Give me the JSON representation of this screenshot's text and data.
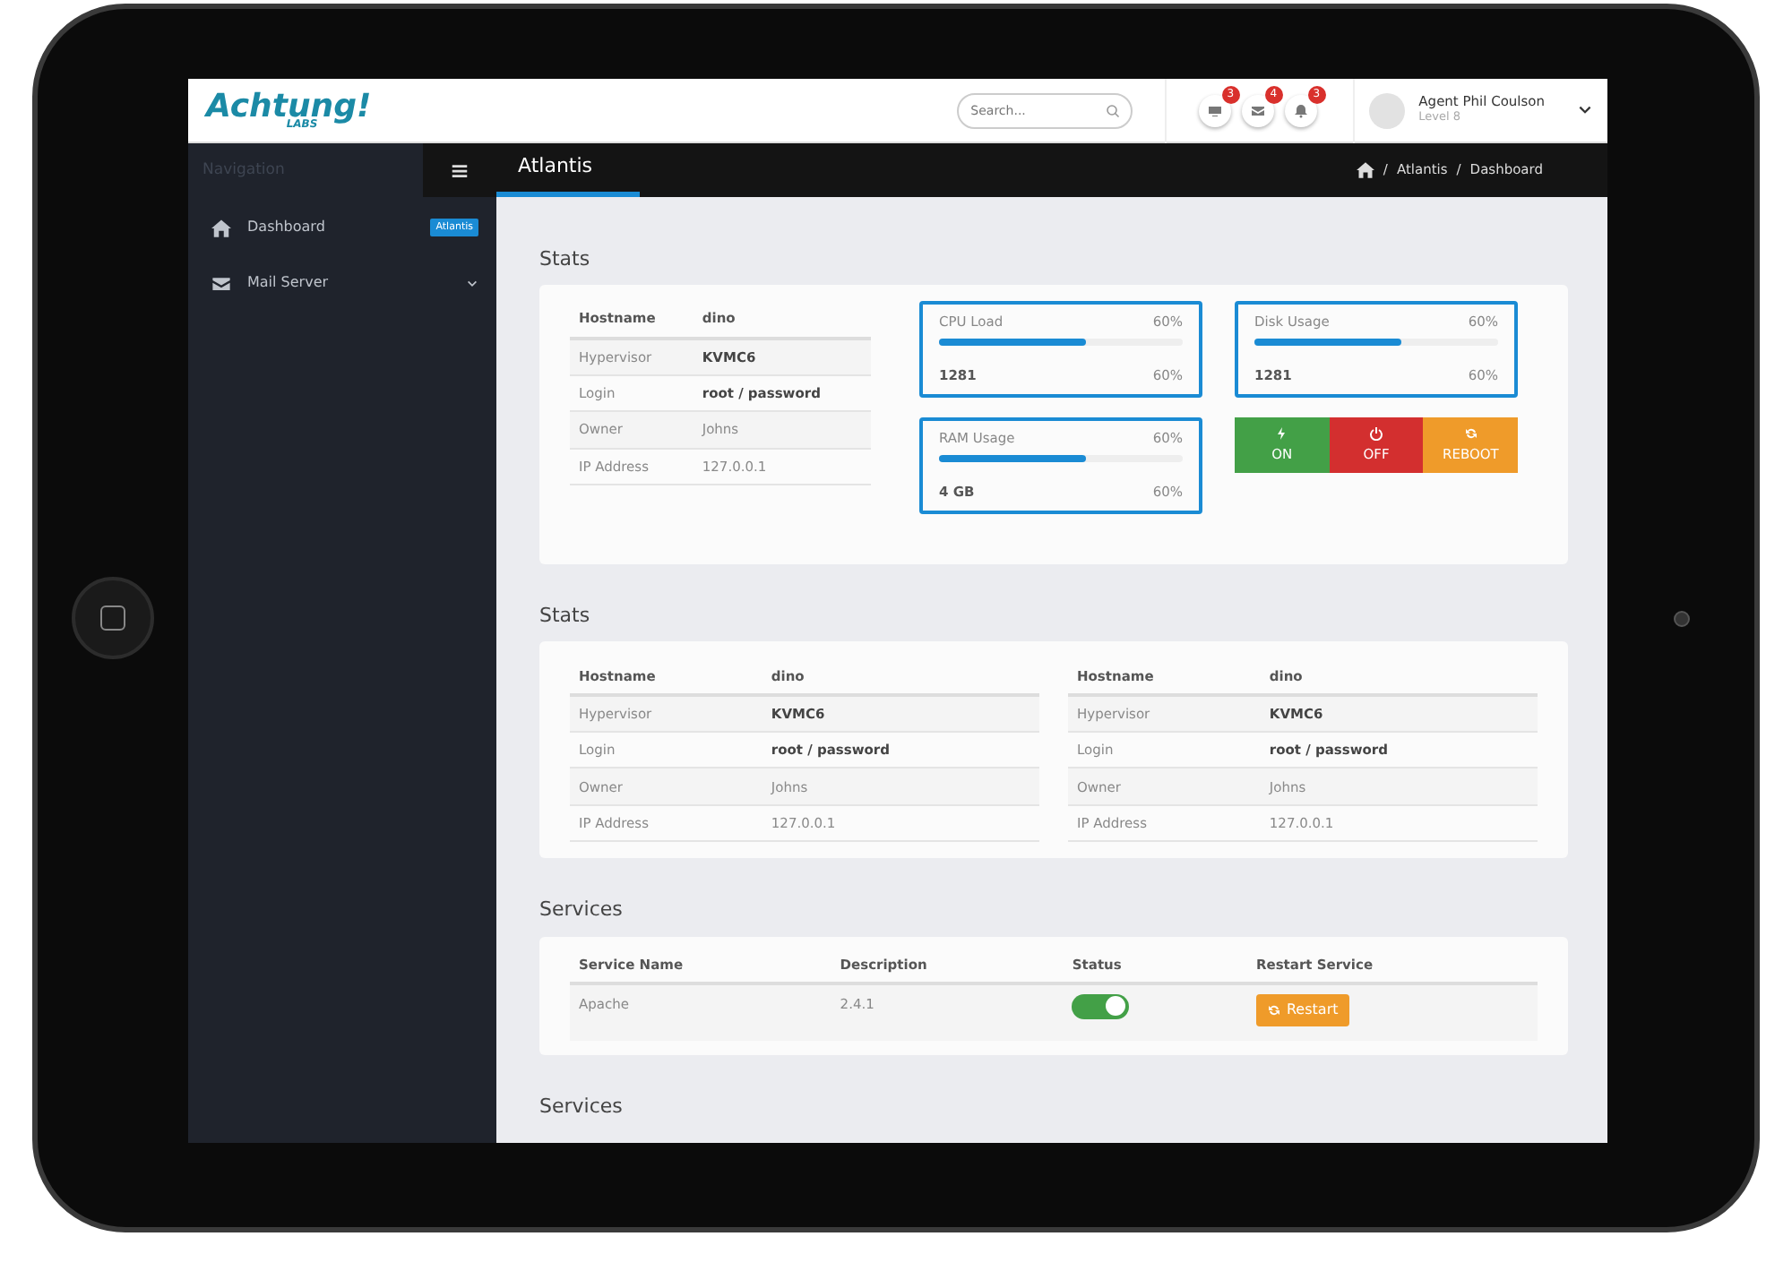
{
  "header": {
    "logo": {
      "text": "Achtung!",
      "sub": "LABS"
    },
    "search": {
      "placeholder": "Search..."
    },
    "notifications": [
      {
        "kind": "screen",
        "count": "3"
      },
      {
        "kind": "mail",
        "count": "4"
      },
      {
        "kind": "bell",
        "count": "3"
      }
    ],
    "user": {
      "name": "Agent Phil Coulson",
      "level": "Level 8"
    }
  },
  "sidebar": {
    "title": "Navigation",
    "items": [
      {
        "kind": "home",
        "label": "Dashboard",
        "badge": "Atlantis",
        "expandable": false
      },
      {
        "kind": "mail",
        "label": "Mail Server",
        "expandable": true
      }
    ]
  },
  "topbar": {
    "title": "Atlantis",
    "separator": "/",
    "breadcrumb": [
      "Atlantis",
      "Dashboard"
    ]
  },
  "sections": [
    {
      "kind": "overview",
      "title": "Stats",
      "table": [
        {
          "label": "Hostname",
          "value": "dino",
          "header": true,
          "bold_value": true
        },
        {
          "label": "Hypervisor",
          "value": "KVMC6",
          "header": false,
          "bold_value": true
        },
        {
          "label": "Login",
          "value": "root / password",
          "header": false,
          "bold_value": true
        },
        {
          "label": "Owner",
          "value": "Johns",
          "header": false,
          "bold_value": false
        },
        {
          "label": "IP Address",
          "value": "127.0.0.1",
          "header": false,
          "bold_value": false
        }
      ],
      "meters": [
        {
          "label": "CPU Load",
          "reading": "60%",
          "level": 0.6,
          "value": "1281",
          "value_reading": "60%"
        },
        {
          "label": "Disk Usage",
          "reading": "60%",
          "level": 0.6,
          "value": "1281",
          "value_reading": "60%"
        },
        {
          "label": "RAM Usage",
          "reading": "60%",
          "level": 0.6,
          "value": "4 GB",
          "value_reading": "60%"
        }
      ],
      "power_buttons": [
        {
          "kind": "on",
          "label": "ON"
        },
        {
          "kind": "off",
          "label": "OFF"
        },
        {
          "kind": "reboot",
          "label": "REBOOT"
        }
      ]
    },
    {
      "kind": "tables",
      "title": "Stats",
      "tables": [
        [
          {
            "label": "Hostname",
            "value": "dino",
            "header": true,
            "bold_value": true
          },
          {
            "label": "Hypervisor",
            "value": "KVMC6",
            "header": false,
            "bold_value": true
          },
          {
            "label": "Login",
            "value": "root / password",
            "header": false,
            "bold_value": true
          },
          {
            "label": "Owner",
            "value": "Johns",
            "header": false,
            "bold_value": false
          },
          {
            "label": "IP Address",
            "value": "127.0.0.1",
            "header": false,
            "bold_value": false
          }
        ],
        [
          {
            "label": "Hostname",
            "value": "dino",
            "header": true,
            "bold_value": true
          },
          {
            "label": "Hypervisor",
            "value": "KVMC6",
            "header": false,
            "bold_value": true
          },
          {
            "label": "Login",
            "value": "root / password",
            "header": false,
            "bold_value": true
          },
          {
            "label": "Owner",
            "value": "Johns",
            "header": false,
            "bold_value": false
          },
          {
            "label": "IP Address",
            "value": "127.0.0.1",
            "header": false,
            "bold_value": false
          }
        ]
      ]
    },
    {
      "kind": "services",
      "title": "Services",
      "columns": [
        "Service Name",
        "Description",
        "Status",
        "Restart Service"
      ],
      "rows": [
        {
          "name": "Apache",
          "description": "2.4.1",
          "on": true,
          "button": "Restart"
        }
      ]
    },
    {
      "kind": "heading",
      "title": "Services"
    }
  ]
}
